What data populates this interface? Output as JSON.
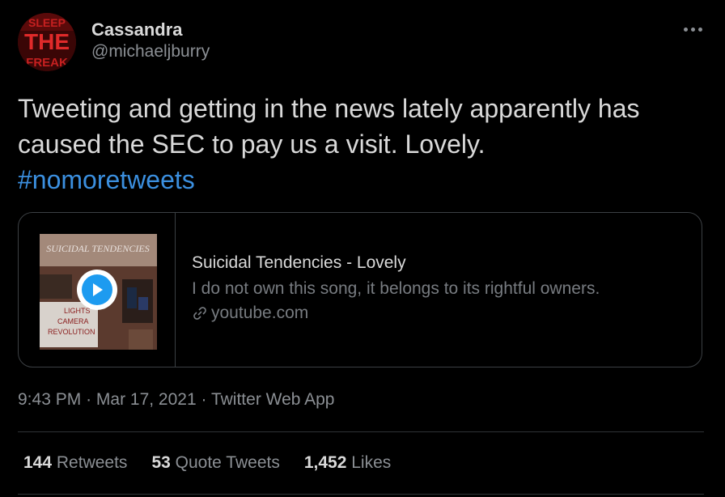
{
  "author": {
    "display_name": "Cassandra",
    "handle": "@michaeljburry",
    "avatar_text": "SLEEP THE FREAK"
  },
  "tweet": {
    "text_line": "Tweeting and getting in the news lately apparently has caused the SEC to pay us a visit. Lovely.",
    "hashtag": "#nomoretweets"
  },
  "card": {
    "title": "Suicidal Tendencies - Lovely",
    "description": "I do not own this song, it belongs to its rightful owners.",
    "domain": "youtube.com",
    "thumb_band": "SUICIDAL TENDENCIES",
    "thumb_marquee": [
      "LIGHTS",
      "CAMERA",
      "REVOLUTION"
    ]
  },
  "meta": {
    "time": "9:43 PM",
    "date": "Mar 17, 2021",
    "source": "Twitter Web App",
    "separator": "·"
  },
  "stats": {
    "retweets_count": "144",
    "retweets_label": "Retweets",
    "quotes_count": "53",
    "quotes_label": "Quote Tweets",
    "likes_count": "1,452",
    "likes_label": "Likes"
  },
  "colors": {
    "background": "#000000",
    "text": "#d9d9d9",
    "muted": "#8b8f94",
    "link": "#3b8fdf",
    "border": "#3c4044"
  }
}
